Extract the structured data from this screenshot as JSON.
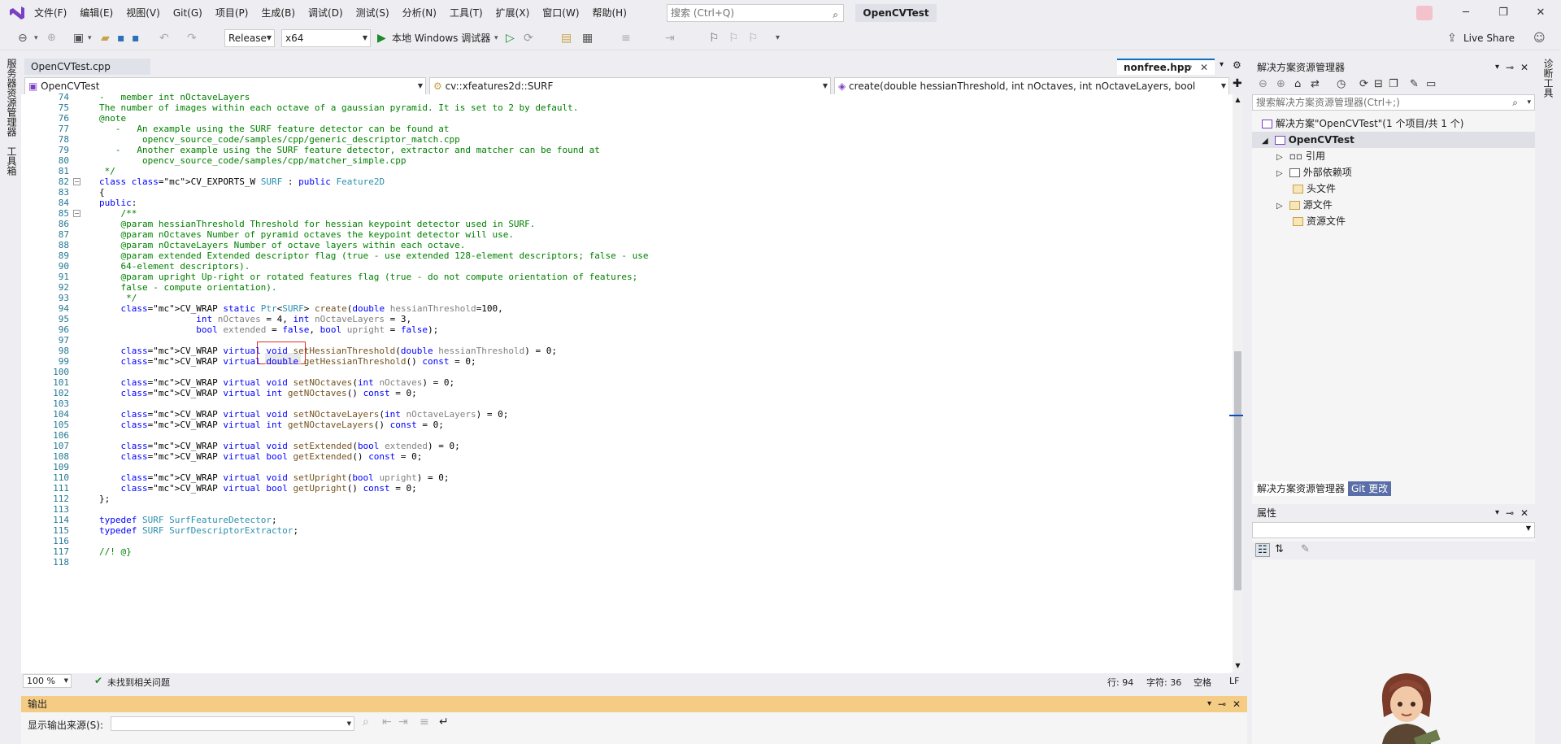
{
  "menu": [
    "文件(F)",
    "编辑(E)",
    "视图(V)",
    "Git(G)",
    "项目(P)",
    "生成(B)",
    "调试(D)",
    "测试(S)",
    "分析(N)",
    "工具(T)",
    "扩展(X)",
    "窗口(W)",
    "帮助(H)"
  ],
  "search": {
    "placeholder": "搜索 (Ctrl+Q)"
  },
  "project_title": "OpenCVTest",
  "live_share": "Live Share",
  "toolbar": {
    "config": "Release",
    "platform": "x64",
    "run_label": "本地 Windows 调试器"
  },
  "left_strip": {
    "tab1": "服务器资源管理器",
    "tab2": "工具箱"
  },
  "right_strip": {
    "tab1": "诊断工具"
  },
  "doc_tabs": {
    "left": "OpenCVTest.cpp",
    "right": "nonfree.hpp"
  },
  "nav": {
    "scope": "OpenCVTest",
    "class": "cv::xfeatures2d::SURF",
    "member": "create(double hessianThreshold, int nOctaves, int nOctaveLayers, bool extende"
  },
  "code_lines": [
    {
      "n": "74",
      "text": "-   member int nOctaveLayers"
    },
    {
      "n": "75",
      "text": "The number of images within each octave of a gaussian pyramid. It is set to 2 by default."
    },
    {
      "n": "76",
      "text": "@note"
    },
    {
      "n": "77",
      "text": "   -   An example using the SURF feature detector can be found at"
    },
    {
      "n": "78",
      "text": "        opencv_source_code/samples/cpp/generic_descriptor_match.cpp"
    },
    {
      "n": "79",
      "text": "   -   Another example using the SURF feature detector, extractor and matcher can be found at"
    },
    {
      "n": "80",
      "text": "        opencv_source_code/samples/cpp/matcher_simple.cpp"
    },
    {
      "n": "81",
      "text": " */"
    },
    {
      "n": "82",
      "text": "class CV_EXPORTS_W SURF : public Feature2D"
    },
    {
      "n": "83",
      "text": "{"
    },
    {
      "n": "84",
      "text": "public:"
    },
    {
      "n": "85",
      "text": "    /**"
    },
    {
      "n": "86",
      "text": "    @param hessianThreshold Threshold for hessian keypoint detector used in SURF."
    },
    {
      "n": "87",
      "text": "    @param nOctaves Number of pyramid octaves the keypoint detector will use."
    },
    {
      "n": "88",
      "text": "    @param nOctaveLayers Number of octave layers within each octave."
    },
    {
      "n": "89",
      "text": "    @param extended Extended descriptor flag (true - use extended 128-element descriptors; false - use"
    },
    {
      "n": "90",
      "text": "    64-element descriptors)."
    },
    {
      "n": "91",
      "text": "    @param upright Up-right or rotated features flag (true - do not compute orientation of features;"
    },
    {
      "n": "92",
      "text": "    false - compute orientation)."
    },
    {
      "n": "93",
      "text": "     */"
    },
    {
      "n": "94",
      "text": "    CV_WRAP static Ptr<SURF> create(double hessianThreshold=100,"
    },
    {
      "n": "95",
      "text": "                  int nOctaves = 4, int nOctaveLayers = 3,"
    },
    {
      "n": "96",
      "text": "                  bool extended = false, bool upright = false);"
    },
    {
      "n": "97",
      "text": ""
    },
    {
      "n": "98",
      "text": "    CV_WRAP virtual void setHessianThreshold(double hessianThreshold) = 0;"
    },
    {
      "n": "99",
      "text": "    CV_WRAP virtual double getHessianThreshold() const = 0;"
    },
    {
      "n": "100",
      "text": ""
    },
    {
      "n": "101",
      "text": "    CV_WRAP virtual void setNOctaves(int nOctaves) = 0;"
    },
    {
      "n": "102",
      "text": "    CV_WRAP virtual int getNOctaves() const = 0;"
    },
    {
      "n": "103",
      "text": ""
    },
    {
      "n": "104",
      "text": "    CV_WRAP virtual void setNOctaveLayers(int nOctaveLayers) = 0;"
    },
    {
      "n": "105",
      "text": "    CV_WRAP virtual int getNOctaveLayers() const = 0;"
    },
    {
      "n": "106",
      "text": ""
    },
    {
      "n": "107",
      "text": "    CV_WRAP virtual void setExtended(bool extended) = 0;"
    },
    {
      "n": "108",
      "text": "    CV_WRAP virtual bool getExtended() const = 0;"
    },
    {
      "n": "109",
      "text": ""
    },
    {
      "n": "110",
      "text": "    CV_WRAP virtual void setUpright(bool upright) = 0;"
    },
    {
      "n": "111",
      "text": "    CV_WRAP virtual bool getUpright() const = 0;"
    },
    {
      "n": "112",
      "text": "};"
    },
    {
      "n": "113",
      "text": ""
    },
    {
      "n": "114",
      "text": "typedef SURF SurfFeatureDetector;"
    },
    {
      "n": "115",
      "text": "typedef SURF SurfDescriptorExtractor;"
    },
    {
      "n": "116",
      "text": ""
    },
    {
      "n": "117",
      "text": "//! @}"
    },
    {
      "n": "118",
      "text": ""
    }
  ],
  "editor_status": {
    "zoom": "100 %",
    "issues": "未找到相关问题",
    "line": "行: 94",
    "col": "字符: 36",
    "ws": "空格",
    "eol": "LF"
  },
  "solution_explorer": {
    "title": "解决方案资源管理器",
    "search_placeholder": "搜索解决方案资源管理器(Ctrl+;)",
    "solution": "解决方案\"OpenCVTest\"(1 个项目/共 1 个)",
    "project": "OpenCVTest",
    "items": [
      "引用",
      "外部依赖项",
      "头文件",
      "源文件",
      "资源文件"
    ],
    "tab_active": "解决方案资源管理器",
    "tab_git": "Git 更改"
  },
  "properties": {
    "title": "属性"
  },
  "output": {
    "title": "输出",
    "source_label": "显示输出来源(S):"
  }
}
